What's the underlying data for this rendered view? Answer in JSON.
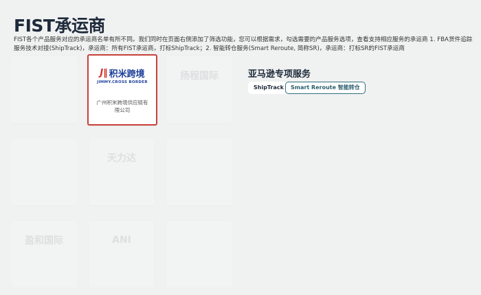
{
  "page_title": "FIST承运商",
  "description": "FIST各个产品服务对应的承运商名单有所不同。我们同时在页面右侧添加了筛选功能，您可以根据需求，勾选需要的产品服务选项，查看支持相应服务的承运商 1. FBA货件追踪服务技术对接(ShipTrack)，承运商：所有FIST承运商，打标ShipTrack；2. 智能转仓服务(Smart Reroute, 简称SR)，承运商：打标SR的FIST承运商",
  "carriers": [
    {
      "logo": "",
      "name": "",
      "selected": false
    },
    {
      "logo": "积米跨境",
      "logo_en": "JIMMY.CROSS BORDER",
      "name": "广州积米跨境供应链有限公司",
      "selected": true
    },
    {
      "logo": "扬程国际",
      "name": "",
      "selected": false
    },
    {
      "logo": "",
      "name": "",
      "selected": false
    },
    {
      "logo": "天力达",
      "name": "",
      "selected": false
    },
    {
      "logo": "",
      "name": "",
      "selected": false
    },
    {
      "logo": "盈和国际",
      "name": "",
      "selected": false
    },
    {
      "logo": "ANI",
      "name": "",
      "selected": false
    },
    {
      "logo": "",
      "name": "",
      "selected": false
    }
  ],
  "services": {
    "title": "亚马逊专项服务",
    "filters": [
      {
        "label": "ShipTrack",
        "active": false
      },
      {
        "label": "Smart Reroute 智能转仓",
        "active": true
      }
    ]
  },
  "colors": {
    "selected_border": "#c8403a",
    "active_filter": "#2f6e7e",
    "brand_blue": "#1b3e9a"
  }
}
